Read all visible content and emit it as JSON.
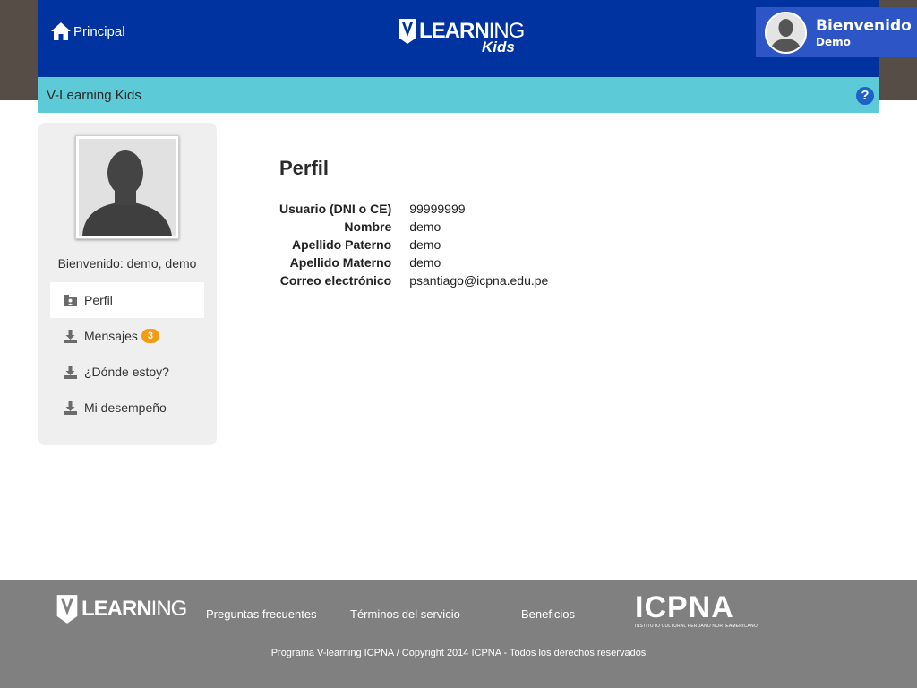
{
  "header": {
    "home_label": "Principal",
    "logo_word_bold": "LEARN",
    "logo_word_thin": "ING",
    "logo_sub": "Kids",
    "welcome_title": "Bienvenido",
    "welcome_user": "Demo"
  },
  "subbar": {
    "title": "V-Learning Kids",
    "help_label": "?"
  },
  "sidebar": {
    "greeting": "Bienvenido: demo, demo",
    "items": [
      {
        "label": "Perfil",
        "icon": "profile-card-icon",
        "active": true
      },
      {
        "label": "Mensajes",
        "icon": "inbox-icon",
        "badge": "3"
      },
      {
        "label": "¿Dónde estoy?",
        "icon": "inbox-icon"
      },
      {
        "label": "Mi desempeño",
        "icon": "inbox-icon"
      }
    ]
  },
  "main": {
    "title": "Perfil",
    "fields": [
      {
        "label": "Usuario (DNI o CE)",
        "value": "99999999"
      },
      {
        "label": "Nombre",
        "value": "demo"
      },
      {
        "label": "Apellido Paterno",
        "value": "demo"
      },
      {
        "label": "Apellido Materno",
        "value": "demo"
      },
      {
        "label": "Correo electrónico",
        "value": "psantiago@icpna.edu.pe"
      }
    ]
  },
  "footer": {
    "logo_word_bold": "LEARN",
    "logo_word_thin": "ING",
    "links": [
      "Preguntas frecuentes",
      "Términos del servicio",
      "Beneficios"
    ],
    "partner_logo": "ICPNA",
    "partner_tagline": "INSTITUTO CULTURAL PERUANO NORTEAMERICANO",
    "copyright": "Programa V-learning ICPNA / Copyright 2014 ICPNA - Todos los derechos reservados"
  },
  "colors": {
    "header_bg": "#0033a0",
    "welcome_bg": "#2d55c6",
    "subbar_bg": "#5ccbd7",
    "badge": "#f39c12",
    "footer_bg": "#808080"
  }
}
